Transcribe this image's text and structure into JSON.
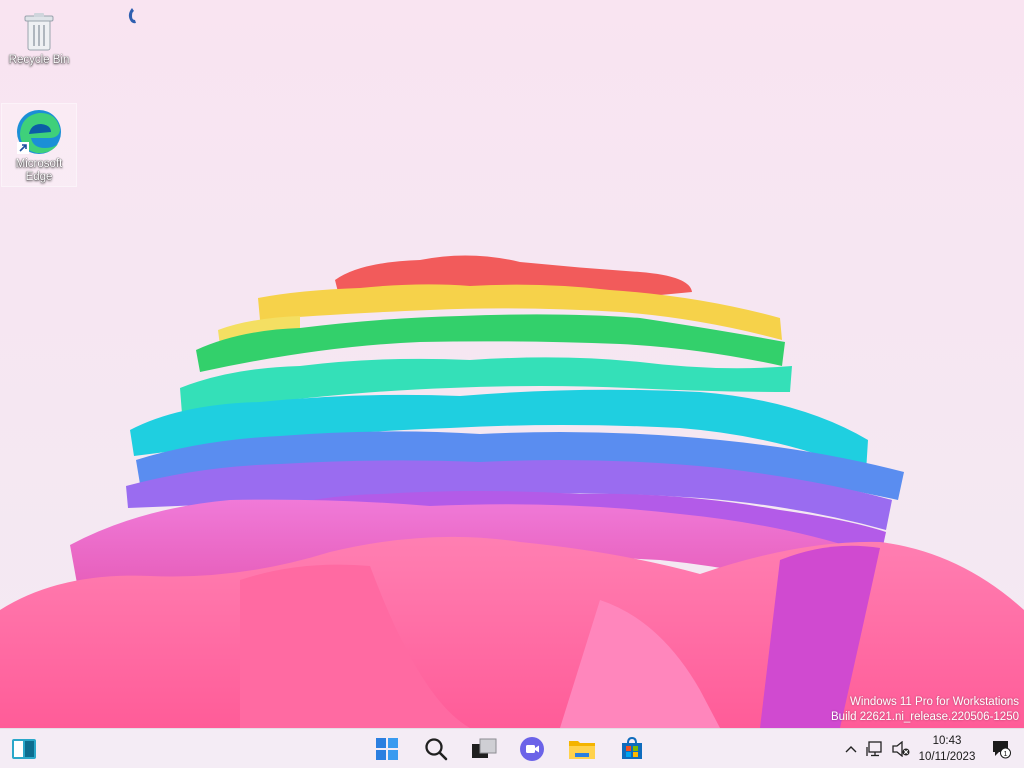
{
  "desktop": {
    "icons": [
      {
        "label": "Recycle Bin",
        "icon": "recycle-bin-icon"
      },
      {
        "label": "Microsoft Edge",
        "icon": "edge-icon"
      }
    ]
  },
  "watermark": {
    "line1": "Windows 11 Pro for Workstations",
    "line2": "Build 22621.ni_release.220506-1250"
  },
  "taskbar": {
    "left": [
      {
        "icon": "widgets-icon"
      }
    ],
    "center": [
      {
        "icon": "start-icon"
      },
      {
        "icon": "search-icon"
      },
      {
        "icon": "task-view-icon"
      },
      {
        "icon": "chat-icon"
      },
      {
        "icon": "file-explorer-icon"
      },
      {
        "icon": "store-icon"
      }
    ],
    "tray": [
      {
        "icon": "chevron-up-icon"
      },
      {
        "icon": "network-icon"
      },
      {
        "icon": "volume-muted-icon"
      }
    ],
    "clock": {
      "time": "10:43",
      "date": "10/11/2023"
    },
    "notifications": {
      "icon": "notification-icon",
      "count": "1"
    }
  }
}
